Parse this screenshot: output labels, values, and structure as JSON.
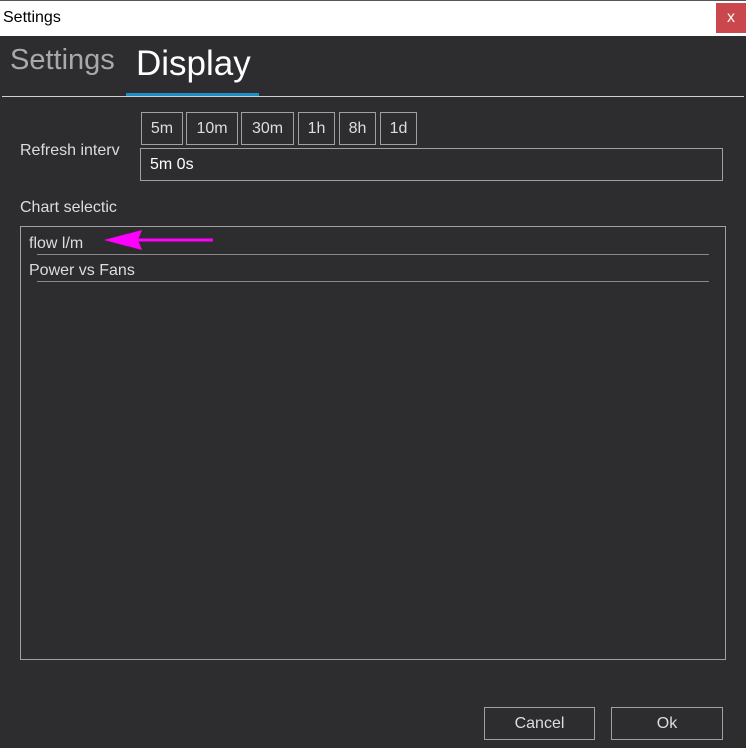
{
  "window": {
    "title": "Settings",
    "close_label": "x"
  },
  "tabs": [
    {
      "label": "Settings"
    },
    {
      "label": "Display",
      "active": true
    }
  ],
  "refresh": {
    "label": "Refresh interv",
    "presets": [
      "5m",
      "10m",
      "30m",
      "1h",
      "8h",
      "1d"
    ],
    "value": "5m 0s"
  },
  "chart_selection": {
    "label": "Chart selectic",
    "items": [
      "flow l/m",
      "Power vs Fans"
    ]
  },
  "annotation": {
    "color": "#ff00ff"
  },
  "footer": {
    "cancel": "Cancel",
    "ok": "Ok"
  }
}
